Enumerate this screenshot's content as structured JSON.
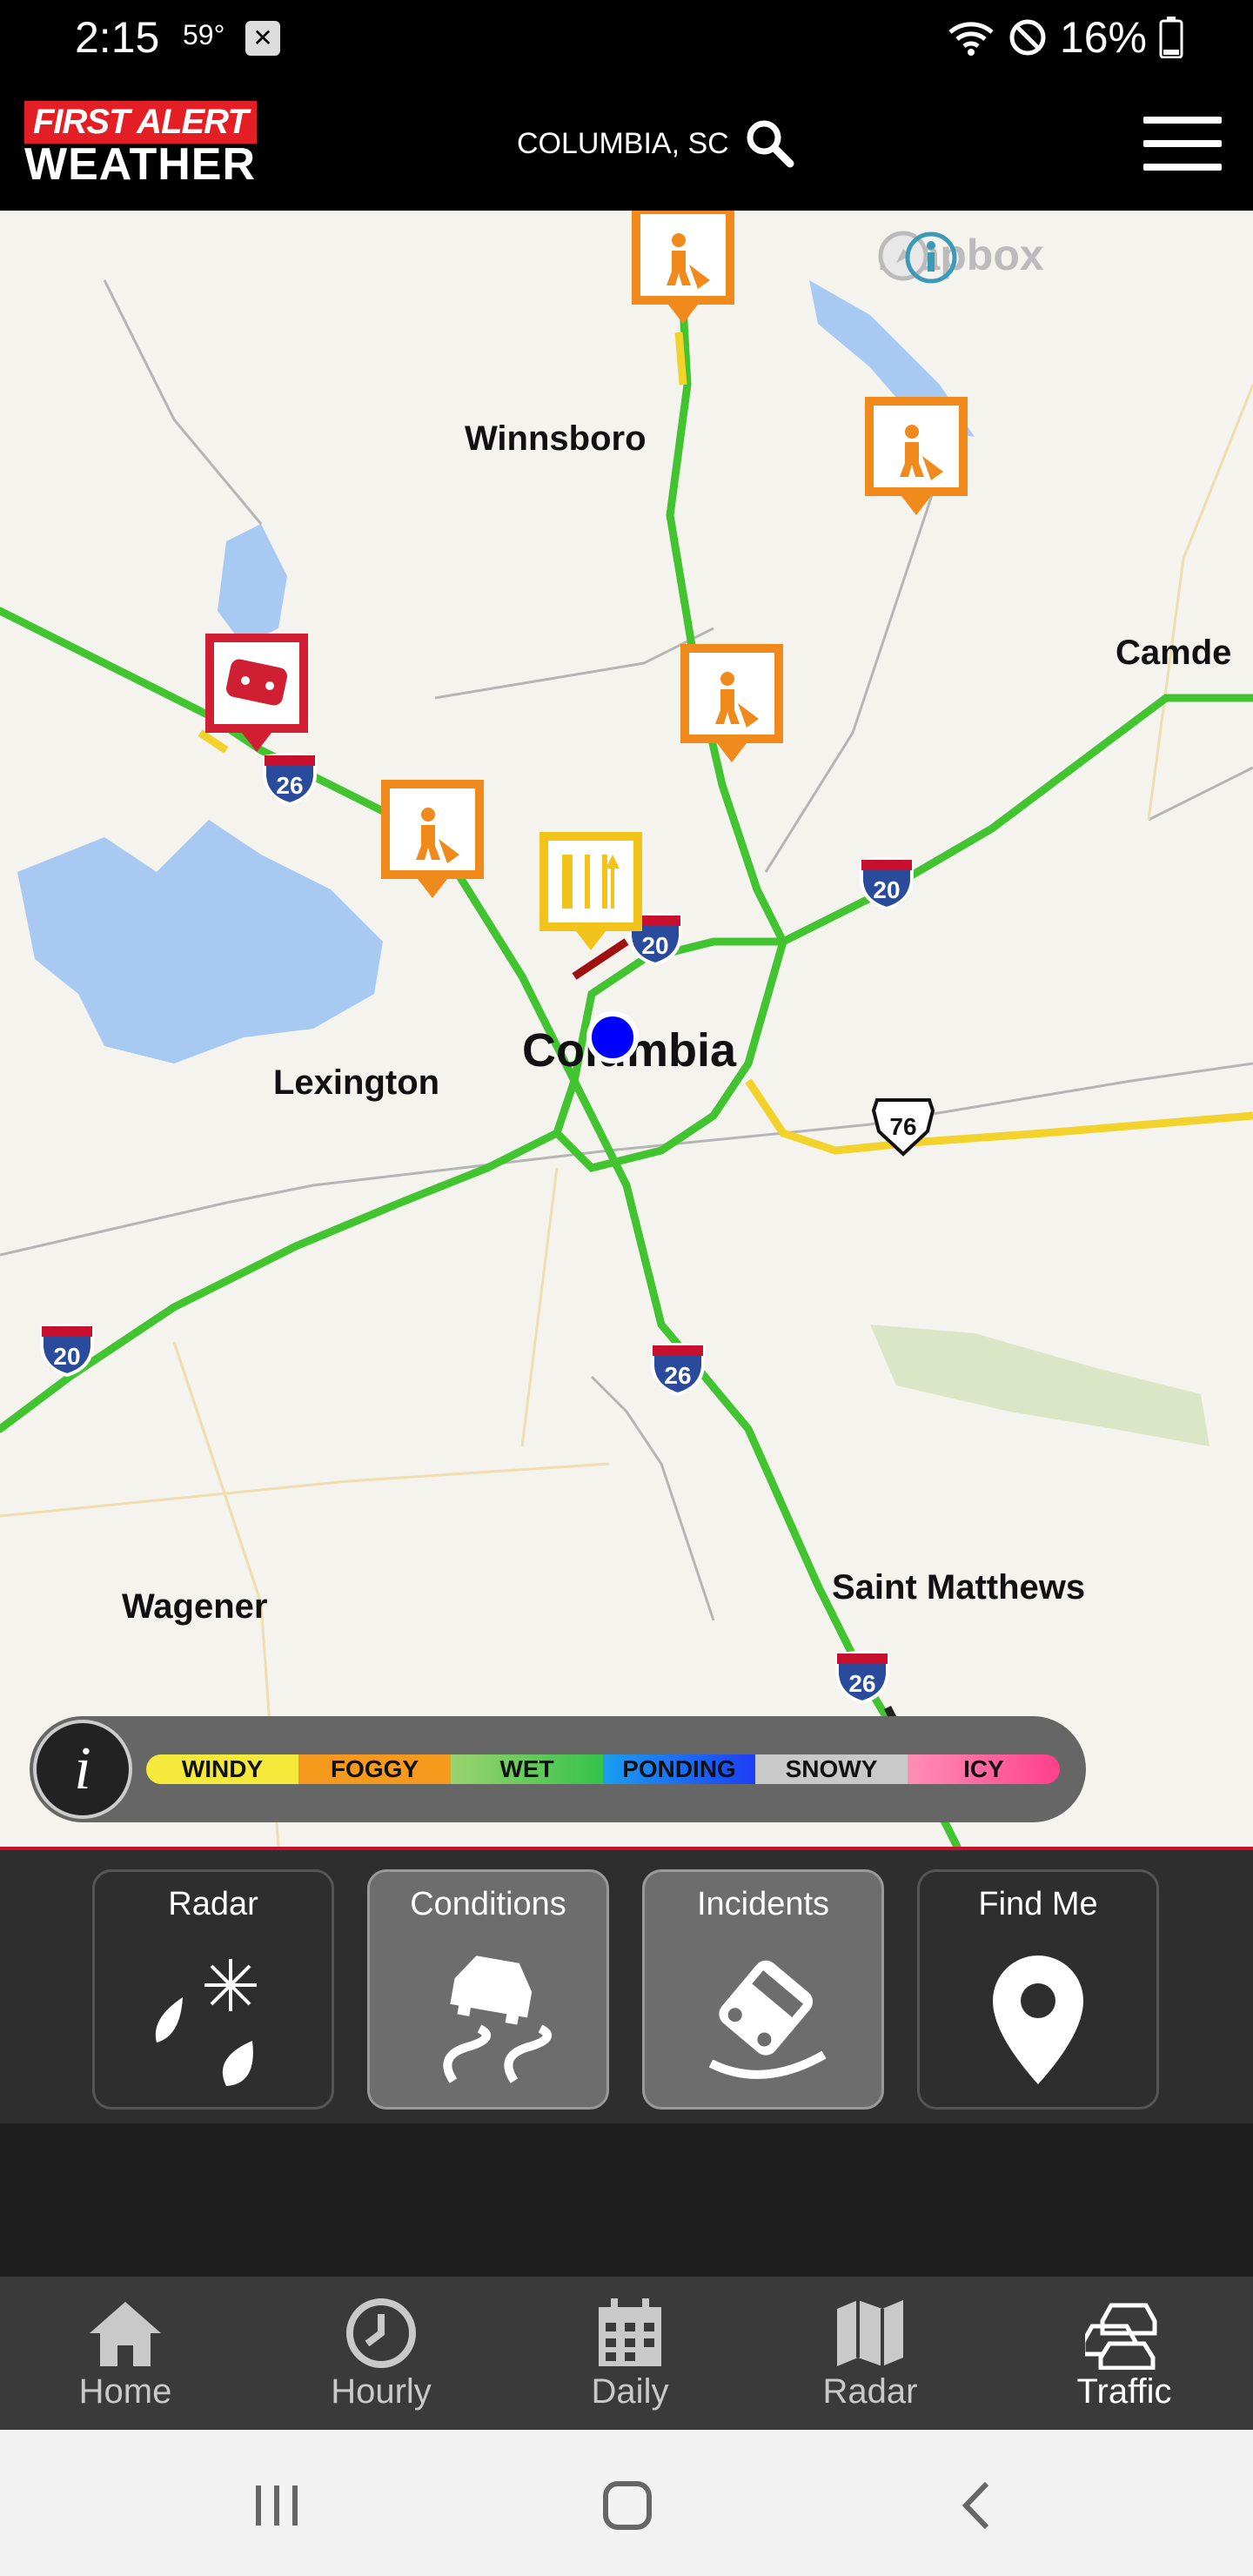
{
  "status": {
    "time": "2:15",
    "temp": "59°",
    "battery": "16%"
  },
  "header": {
    "location": "COLUMBIA, SC",
    "logo_line1": "FIRST ALERT",
    "logo_line2": "WEATHER"
  },
  "map": {
    "attribution": "mapbox",
    "cities": [
      {
        "name": "Winnsboro"
      },
      {
        "name": "Camde"
      },
      {
        "name": "Lexington"
      },
      {
        "name": "Columbia"
      },
      {
        "name": "Wagener"
      },
      {
        "name": "Saint Matthews"
      }
    ],
    "shields": {
      "i26": "26",
      "i20": "20",
      "us76": "76"
    }
  },
  "legend": {
    "info": "i",
    "items": [
      {
        "label": "WINDY",
        "color": "#f5ea3b"
      },
      {
        "label": "FOGGY",
        "color": "#f59a1c"
      },
      {
        "label": "WET",
        "color": "#34c24a"
      },
      {
        "label": "PONDING",
        "color": "#1e5ef5"
      },
      {
        "label": "SNOWY",
        "color": "#c9c9c9"
      },
      {
        "label": "ICY",
        "color": "#ff5ba0"
      }
    ]
  },
  "panel": {
    "buttons": [
      {
        "label": "Radar",
        "icon": "rain-snow-icon",
        "active": false
      },
      {
        "label": "Conditions",
        "icon": "slippery-road-icon",
        "active": true
      },
      {
        "label": "Incidents",
        "icon": "crash-icon",
        "active": true
      },
      {
        "label": "Find Me",
        "icon": "location-pin-icon",
        "active": false
      }
    ]
  },
  "tabs": [
    {
      "label": "Home",
      "icon": "home-icon"
    },
    {
      "label": "Hourly",
      "icon": "clock-icon"
    },
    {
      "label": "Daily",
      "icon": "calendar-icon"
    },
    {
      "label": "Radar",
      "icon": "map-icon"
    },
    {
      "label": "Traffic",
      "icon": "traffic-icon",
      "active": true
    }
  ]
}
